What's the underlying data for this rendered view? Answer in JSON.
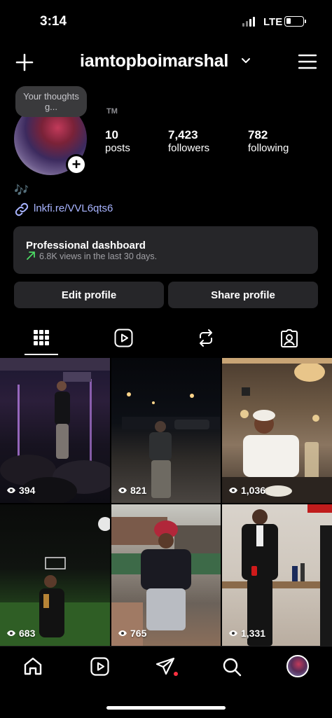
{
  "status_bar": {
    "time": "3:14",
    "network": "LTE"
  },
  "header": {
    "username": "iamtopboimarshal"
  },
  "profile": {
    "note": "Your thoughts g...",
    "display_name": "TM",
    "bio_emoji": "🎶",
    "link": "lnkfi.re/VVL6qts6",
    "stats": {
      "posts": {
        "value": "10",
        "label": "posts"
      },
      "followers": {
        "value": "7,423",
        "label": "followers"
      },
      "following": {
        "value": "782",
        "label": "following"
      }
    }
  },
  "dashboard": {
    "title": "Professional dashboard",
    "subtitle": "6.8K views in the last 30 days."
  },
  "buttons": {
    "edit": "Edit profile",
    "share": "Share profile"
  },
  "tabs": [
    "grid",
    "reels",
    "reposts",
    "tagged"
  ],
  "grid": [
    {
      "views": "394"
    },
    {
      "views": "821"
    },
    {
      "views": "1,036"
    },
    {
      "views": "683"
    },
    {
      "views": "765"
    },
    {
      "views": "1,331"
    }
  ],
  "bottom_nav": [
    "home",
    "reels",
    "messages",
    "search",
    "profile"
  ],
  "colors": {
    "link": "#a8b4ff",
    "dashboard_arrow": "#4cd964",
    "notification": "#ff3040"
  }
}
